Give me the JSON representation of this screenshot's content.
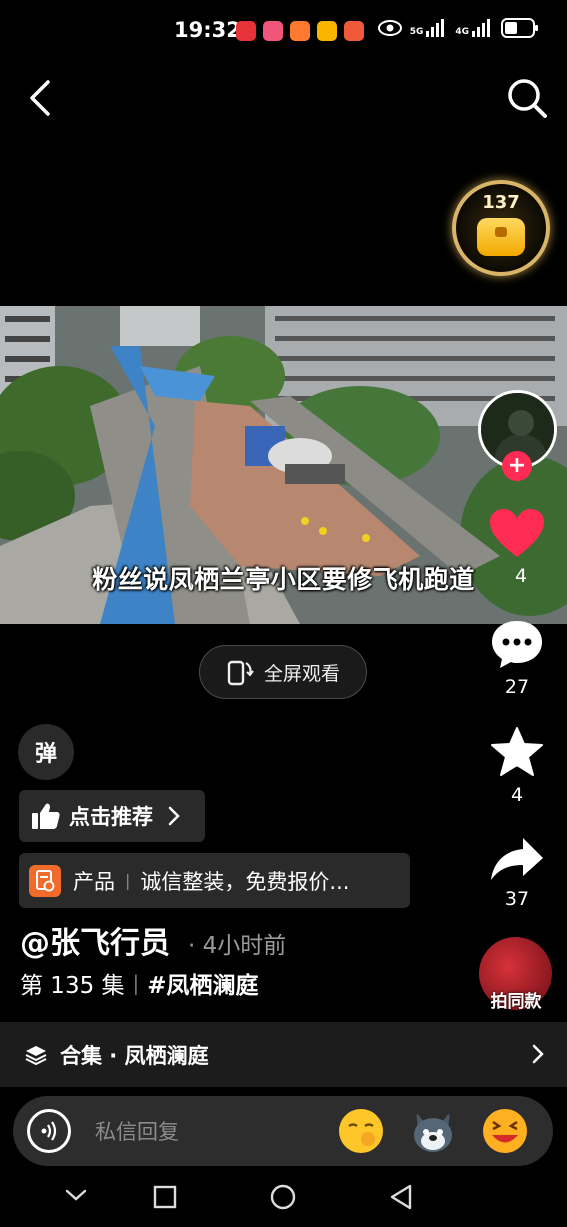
{
  "status_bar": {
    "time": "19:32",
    "network_1": "5G",
    "network_2": "4G",
    "notification_icons": [
      "app-icon-red",
      "app-icon-pink",
      "app-icon-orange",
      "app-icon-yellow",
      "app-icon-red-orange"
    ]
  },
  "reward": {
    "count": "137"
  },
  "video": {
    "subtitle": "粉丝说凤栖兰亭小区要修飞机跑道"
  },
  "fullscreen_label": "全屏观看",
  "actions": {
    "likes": "4",
    "comments": "27",
    "favorites": "4",
    "shares": "37",
    "shoot_same": "拍同款"
  },
  "danmaku_label": "弹",
  "recommend_label": "点击推荐",
  "product": {
    "tag": "产品",
    "text": "诚信整装，免费报价..."
  },
  "author": {
    "name": "@张飞行员",
    "time": "· 4小时前"
  },
  "episode": {
    "label": "第 135 集",
    "hashtag": "#凤栖澜庭"
  },
  "collection": {
    "label": "合集 · 凤栖澜庭"
  },
  "reply": {
    "placeholder": "私信回复"
  },
  "colors": {
    "like": "#fe2c55",
    "background": "#000000",
    "card": "#2a2a2a"
  }
}
